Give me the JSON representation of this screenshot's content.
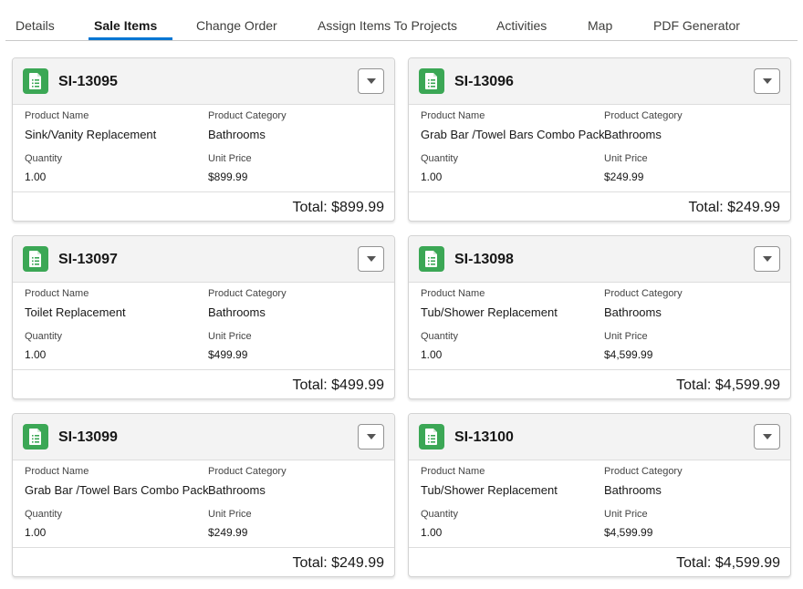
{
  "tabs": [
    {
      "label": "Details"
    },
    {
      "label": "Sale Items"
    },
    {
      "label": "Change Order"
    },
    {
      "label": "Assign Items To Projects"
    },
    {
      "label": "Activities"
    },
    {
      "label": "Map"
    },
    {
      "label": "PDF Generator"
    }
  ],
  "active_tab": "Sale Items",
  "field_labels": {
    "product_name": "Product Name",
    "product_category": "Product Category",
    "quantity": "Quantity",
    "unit_price": "Unit Price"
  },
  "cards": [
    {
      "id": "SI-13095",
      "product_name": "Sink/Vanity Replacement",
      "product_category": "Bathrooms",
      "quantity": "1.00",
      "unit_price": "$899.99",
      "total": "Total: $899.99"
    },
    {
      "id": "SI-13096",
      "product_name": "Grab Bar /Towel Bars Combo Pack",
      "product_category": "Bathrooms",
      "quantity": "1.00",
      "unit_price": "$249.99",
      "total": "Total: $249.99"
    },
    {
      "id": "SI-13097",
      "product_name": "Toilet Replacement",
      "product_category": "Bathrooms",
      "quantity": "1.00",
      "unit_price": "$499.99",
      "total": "Total: $499.99"
    },
    {
      "id": "SI-13098",
      "product_name": "Tub/Shower Replacement",
      "product_category": "Bathrooms",
      "quantity": "1.00",
      "unit_price": "$4,599.99",
      "total": "Total: $4,599.99"
    },
    {
      "id": "SI-13099",
      "product_name": "Grab Bar /Towel Bars Combo Pack",
      "product_category": "Bathrooms",
      "quantity": "1.00",
      "unit_price": "$249.99",
      "total": "Total: $249.99"
    },
    {
      "id": "SI-13100",
      "product_name": "Tub/Shower Replacement",
      "product_category": "Bathrooms",
      "quantity": "1.00",
      "unit_price": "$4,599.99",
      "total": "Total: $4,599.99"
    }
  ],
  "icons": {
    "record": "document-list-icon",
    "menu": "chevron-down-icon"
  },
  "colors": {
    "accent": "#0176d3",
    "record_icon": "#3ba755"
  }
}
